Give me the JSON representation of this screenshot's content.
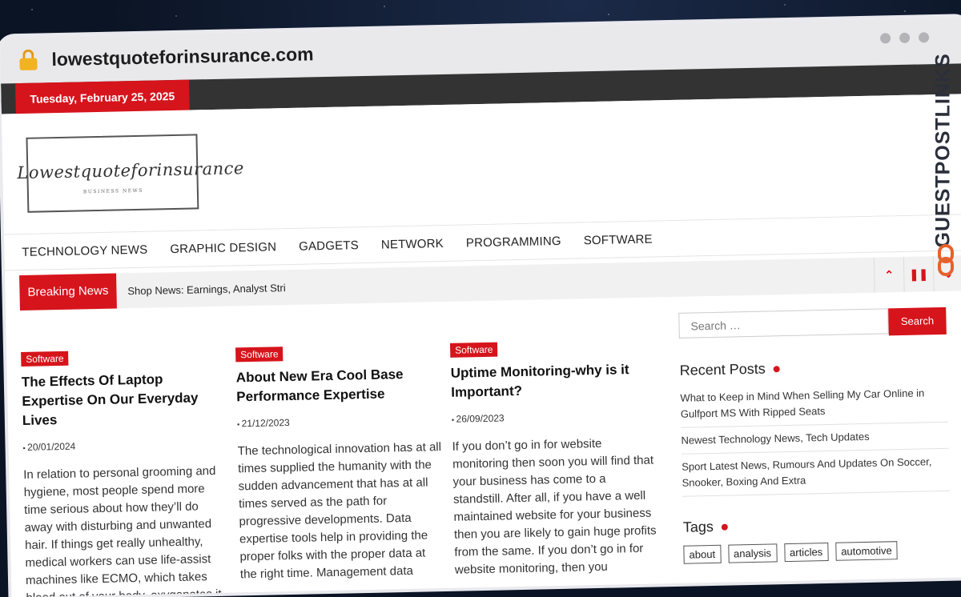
{
  "browser": {
    "url": "lowestquoteforinsurance.com"
  },
  "topbar": {
    "date": "Tuesday, February 25, 2025"
  },
  "logo": {
    "title": "Lowestquoteforinsurance",
    "subtitle": "BUSINESS NEWS"
  },
  "nav": {
    "items": [
      "TECHNOLOGY NEWS",
      "GRAPHIC DESIGN",
      "GADGETS",
      "NETWORK",
      "PROGRAMMING",
      "SOFTWARE"
    ]
  },
  "breaking": {
    "label": "Breaking News",
    "text": "Shop News: Earnings, Analyst Stri"
  },
  "posts": [
    {
      "category": "Software",
      "title": "The Effects Of Laptop Expertise On Our Everyday Lives",
      "date": "20/01/2024",
      "excerpt": "In relation to personal grooming and hygiene, most people spend more time serious about how they’ll do away with disturbing and unwanted hair. If things get really unhealthy, medical workers can use life-assist machines like ECMO, which takes blood out of your body, oxygenates it"
    },
    {
      "category": "Software",
      "title": "About New Era Cool Base Performance Expertise",
      "date": "21/12/2023",
      "excerpt": "The technological innovation has at all times supplied the humanity with the sudden advancement that has at all times served as the path for progressive developments. Data expertise tools help in providing the proper folks with the proper data at the right time. Management data"
    },
    {
      "category": "Software",
      "title": "Uptime Monitoring-why is it Important?",
      "date": "26/09/2023",
      "excerpt": "If you don’t go in for website monitoring then soon you will find that your business has come to a standstill. After all, if you have a well maintained website for your business then you are likely to gain huge profits from the same. If you don’t go in for website monitoring, then you"
    }
  ],
  "sidebar": {
    "search_placeholder": "Search …",
    "search_button": "Search",
    "recent_heading": "Recent Posts",
    "recent": [
      "What to Keep in Mind When Selling My Car Online in Gulfport MS With Ripped Seats",
      "Newest Technology News, Tech Updates",
      "Sport Latest News, Rumours And Updates On Soccer, Snooker, Boxing And Extra"
    ],
    "tags_heading": "Tags",
    "tags": [
      "about",
      "analysis",
      "articles",
      "automotive"
    ]
  },
  "watermark": {
    "text": "GUESTPOSTLINKS"
  },
  "colors": {
    "accent": "#d6141c",
    "topbar": "#333333"
  }
}
